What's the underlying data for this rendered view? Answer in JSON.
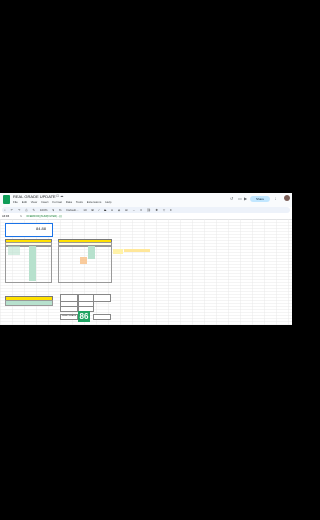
{
  "app": {
    "title": "REAL GRADE UPDATE",
    "menus": [
      "File",
      "Edit",
      "View",
      "Insert",
      "Format",
      "Data",
      "Tools",
      "Extensions",
      "Help"
    ],
    "share_label": "Share"
  },
  "toolbar": {
    "zoom": "100%",
    "font": "Default...",
    "font_size": "10"
  },
  "formula_bar": {
    "name_box": "A6:D6",
    "fx": "fx",
    "formula": "=IFERROR((SUM(FILTER(...)))"
  },
  "cells": {
    "popup_value": "84.88",
    "score": "86",
    "score_label": "FINAL GRADE"
  },
  "colors": {
    "header_yellow": "#ffe000",
    "green_cell": "#b7e1cd",
    "score_green": "#1fa463",
    "accent_blue": "#1a73e8"
  }
}
